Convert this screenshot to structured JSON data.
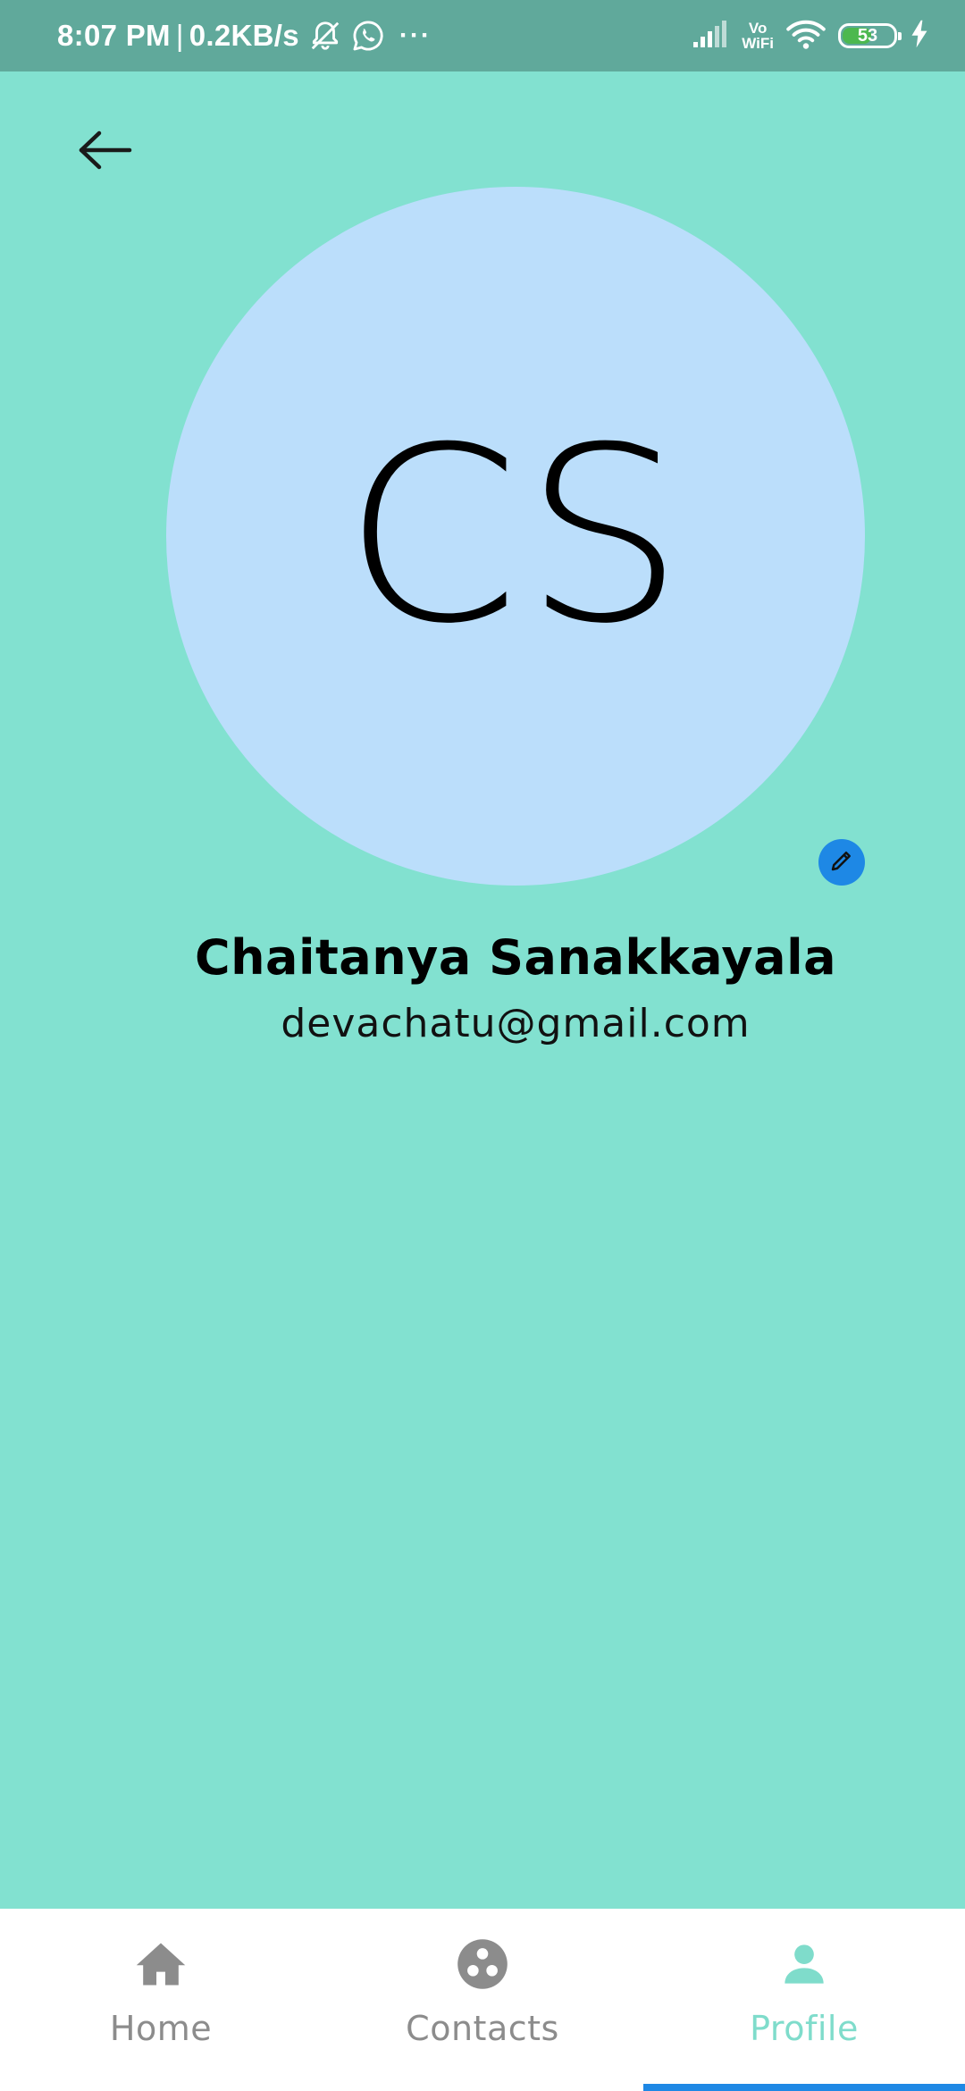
{
  "status_bar": {
    "time": "8:07 PM",
    "separator": "|",
    "net_speed": "0.2KB/s",
    "more": "···",
    "vowifi_top": "Vo",
    "vowifi_bottom": "WiFi",
    "battery_level": "53",
    "battery_fraction": 0.53,
    "icons": [
      "mute-notifications-icon",
      "whatsapp-icon",
      "signal-icon",
      "wifi-icon",
      "battery-icon",
      "charging-icon"
    ]
  },
  "header": {
    "back_icon": "arrow-left-icon"
  },
  "profile": {
    "initials": "CS",
    "name": "Chaitanya Sanakkayala",
    "email": "devachatu@gmail.com",
    "edit_icon": "pencil-icon"
  },
  "bottom_nav": {
    "items": [
      {
        "label": "Home",
        "icon": "home-icon",
        "active": false
      },
      {
        "label": "Contacts",
        "icon": "contacts-icon",
        "active": false
      },
      {
        "label": "Profile",
        "icon": "person-icon",
        "active": true
      }
    ]
  },
  "colors": {
    "background": "#82e1d0",
    "status_bar": "#60a99b",
    "avatar": "#bbdefb",
    "accent": "#1e88e5",
    "active_tab": "#7fdccb",
    "inactive_tab": "#8c8c8c"
  }
}
